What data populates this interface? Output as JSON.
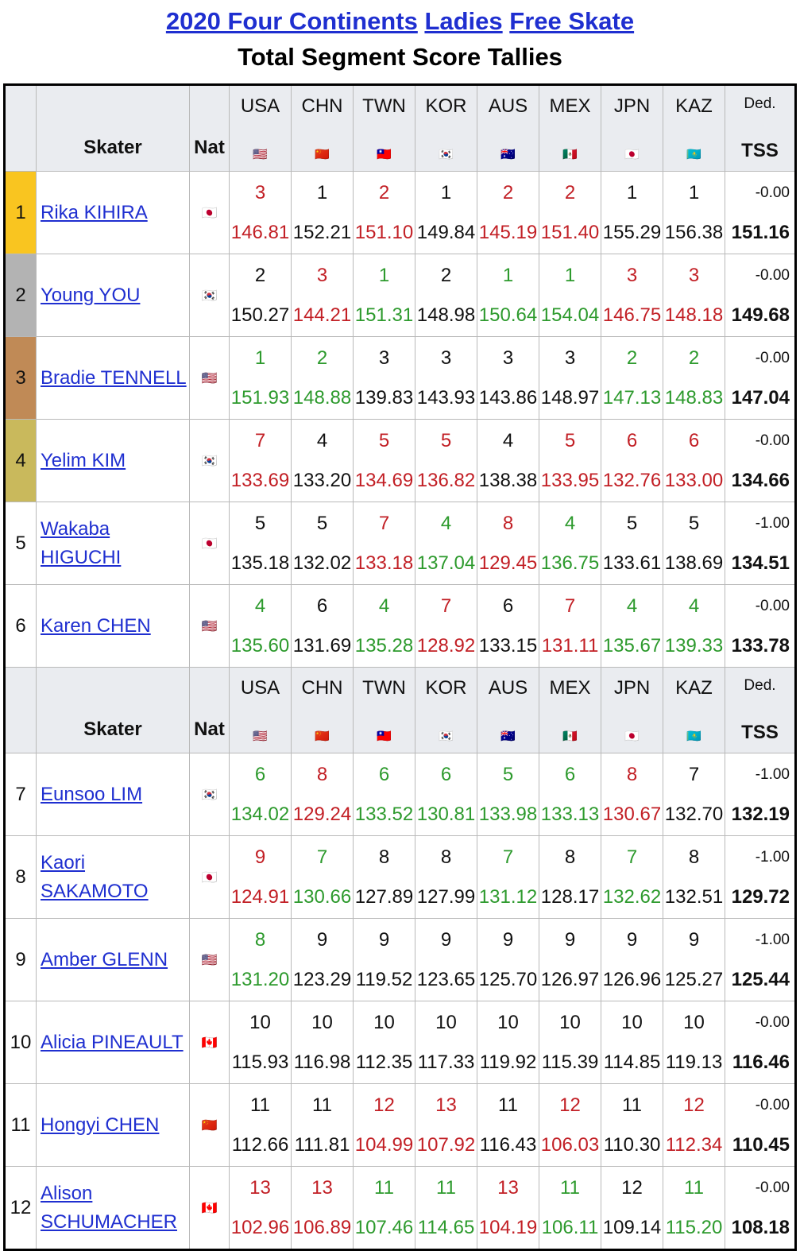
{
  "title": {
    "year_event": "2020 Four Continents",
    "category": "Ladies",
    "segment": "Free Skate",
    "subtitle": "Total Segment Score Tallies"
  },
  "header": {
    "skater": "Skater",
    "nat": "Nat",
    "judges": [
      "USA",
      "CHN",
      "TWN",
      "KOR",
      "AUS",
      "MEX",
      "JPN",
      "KAZ"
    ],
    "judge_flags": [
      "🇺🇸",
      "🇨🇳",
      "🇹🇼",
      "🇰🇷",
      "🇦🇺",
      "🇲🇽",
      "🇯🇵",
      "🇰🇿"
    ],
    "ded": "Ded.",
    "tss": "TSS"
  },
  "colors": {
    "gold": "#f9c520",
    "silver": "#b3b3b3",
    "bronze": "#c08a56",
    "fourth": "#c9b95c",
    "red": "#c21f25",
    "green": "#2d9a2d",
    "link": "#1f2fd0",
    "header_bg": "#eaecf0"
  },
  "skaters_top": [
    {
      "rank": "1",
      "name": "Rika KIHIRA",
      "nat_flag": "🇯🇵",
      "ranks": [
        "3",
        "1",
        "2",
        "1",
        "2",
        "2",
        "1",
        "1"
      ],
      "scores": [
        "146.81",
        "152.21",
        "151.10",
        "149.84",
        "145.19",
        "151.40",
        "155.29",
        "156.38"
      ],
      "colors": [
        "r",
        "k",
        "r",
        "k",
        "r",
        "r",
        "k",
        "k"
      ],
      "ded": "-0.00",
      "tss": "151.16"
    },
    {
      "rank": "2",
      "name": "Young YOU",
      "nat_flag": "🇰🇷",
      "ranks": [
        "2",
        "3",
        "1",
        "2",
        "1",
        "1",
        "3",
        "3"
      ],
      "scores": [
        "150.27",
        "144.21",
        "151.31",
        "148.98",
        "150.64",
        "154.04",
        "146.75",
        "148.18"
      ],
      "colors": [
        "k",
        "r",
        "g",
        "k",
        "g",
        "g",
        "r",
        "r"
      ],
      "ded": "-0.00",
      "tss": "149.68"
    },
    {
      "rank": "3",
      "name": "Bradie TENNELL",
      "nat_flag": "🇺🇸",
      "ranks": [
        "1",
        "2",
        "3",
        "3",
        "3",
        "3",
        "2",
        "2"
      ],
      "scores": [
        "151.93",
        "148.88",
        "139.83",
        "143.93",
        "143.86",
        "148.97",
        "147.13",
        "148.83"
      ],
      "colors": [
        "g",
        "g",
        "k",
        "k",
        "k",
        "k",
        "g",
        "g"
      ],
      "ded": "-0.00",
      "tss": "147.04"
    },
    {
      "rank": "4",
      "name": "Yelim KIM",
      "nat_flag": "🇰🇷",
      "ranks": [
        "7",
        "4",
        "5",
        "5",
        "4",
        "5",
        "6",
        "6"
      ],
      "scores": [
        "133.69",
        "133.20",
        "134.69",
        "136.82",
        "138.38",
        "133.95",
        "132.76",
        "133.00"
      ],
      "colors": [
        "r",
        "k",
        "r",
        "r",
        "k",
        "r",
        "r",
        "r"
      ],
      "ded": "-0.00",
      "tss": "134.66"
    },
    {
      "rank": "5",
      "name": "Wakaba HIGUCHI",
      "nat_flag": "🇯🇵",
      "ranks": [
        "5",
        "5",
        "7",
        "4",
        "8",
        "4",
        "5",
        "5"
      ],
      "scores": [
        "135.18",
        "132.02",
        "133.18",
        "137.04",
        "129.45",
        "136.75",
        "133.61",
        "138.69"
      ],
      "colors": [
        "k",
        "k",
        "r",
        "g",
        "r",
        "g",
        "k",
        "k"
      ],
      "ded": "-1.00",
      "tss": "134.51"
    },
    {
      "rank": "6",
      "name": "Karen CHEN",
      "nat_flag": "🇺🇸",
      "ranks": [
        "4",
        "6",
        "4",
        "7",
        "6",
        "7",
        "4",
        "4"
      ],
      "scores": [
        "135.60",
        "131.69",
        "135.28",
        "128.92",
        "133.15",
        "131.11",
        "135.67",
        "139.33"
      ],
      "colors": [
        "g",
        "k",
        "g",
        "r",
        "k",
        "r",
        "g",
        "g"
      ],
      "ded": "-0.00",
      "tss": "133.78"
    }
  ],
  "skaters_bottom": [
    {
      "rank": "7",
      "name": "Eunsoo LIM",
      "nat_flag": "🇰🇷",
      "ranks": [
        "6",
        "8",
        "6",
        "6",
        "5",
        "6",
        "8",
        "7"
      ],
      "scores": [
        "134.02",
        "129.24",
        "133.52",
        "130.81",
        "133.98",
        "133.13",
        "130.67",
        "132.70"
      ],
      "colors": [
        "g",
        "r",
        "g",
        "g",
        "g",
        "g",
        "r",
        "k"
      ],
      "ded": "-1.00",
      "tss": "132.19"
    },
    {
      "rank": "8",
      "name": "Kaori SAKAMOTO",
      "nat_flag": "🇯🇵",
      "ranks": [
        "9",
        "7",
        "8",
        "8",
        "7",
        "8",
        "7",
        "8"
      ],
      "scores": [
        "124.91",
        "130.66",
        "127.89",
        "127.99",
        "131.12",
        "128.17",
        "132.62",
        "132.51"
      ],
      "colors": [
        "r",
        "g",
        "k",
        "k",
        "g",
        "k",
        "g",
        "k"
      ],
      "ded": "-1.00",
      "tss": "129.72"
    },
    {
      "rank": "9",
      "name": "Amber GLENN",
      "nat_flag": "🇺🇸",
      "ranks": [
        "8",
        "9",
        "9",
        "9",
        "9",
        "9",
        "9",
        "9"
      ],
      "scores": [
        "131.20",
        "123.29",
        "119.52",
        "123.65",
        "125.70",
        "126.97",
        "126.96",
        "125.27"
      ],
      "colors": [
        "g",
        "k",
        "k",
        "k",
        "k",
        "k",
        "k",
        "k"
      ],
      "ded": "-1.00",
      "tss": "125.44"
    },
    {
      "rank": "10",
      "name": "Alicia PINEAULT",
      "nat_flag": "🇨🇦",
      "ranks": [
        "10",
        "10",
        "10",
        "10",
        "10",
        "10",
        "10",
        "10"
      ],
      "scores": [
        "115.93",
        "116.98",
        "112.35",
        "117.33",
        "119.92",
        "115.39",
        "114.85",
        "119.13"
      ],
      "colors": [
        "k",
        "k",
        "k",
        "k",
        "k",
        "k",
        "k",
        "k"
      ],
      "ded": "-0.00",
      "tss": "116.46"
    },
    {
      "rank": "11",
      "name": "Hongyi CHEN",
      "nat_flag": "🇨🇳",
      "ranks": [
        "11",
        "11",
        "12",
        "13",
        "11",
        "12",
        "11",
        "12"
      ],
      "scores": [
        "112.66",
        "111.81",
        "104.99",
        "107.92",
        "116.43",
        "106.03",
        "110.30",
        "112.34"
      ],
      "colors": [
        "k",
        "k",
        "r",
        "r",
        "k",
        "r",
        "k",
        "r"
      ],
      "ded": "-0.00",
      "tss": "110.45"
    },
    {
      "rank": "12",
      "name": "Alison SCHUMACHER",
      "nat_flag": "🇨🇦",
      "ranks": [
        "13",
        "13",
        "11",
        "11",
        "13",
        "11",
        "12",
        "11"
      ],
      "scores": [
        "102.96",
        "106.89",
        "107.46",
        "114.65",
        "104.19",
        "106.11",
        "109.14",
        "115.20"
      ],
      "colors": [
        "r",
        "r",
        "g",
        "g",
        "r",
        "g",
        "k",
        "g"
      ],
      "ded": "-0.00",
      "tss": "108.18"
    }
  ]
}
